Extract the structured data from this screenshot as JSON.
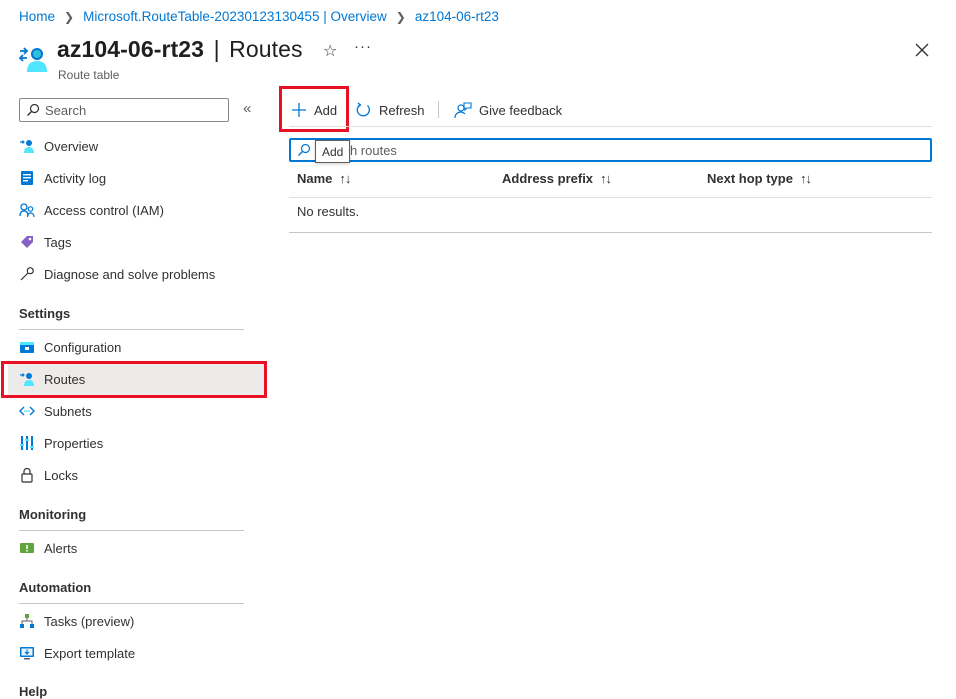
{
  "breadcrumb": {
    "items": [
      "Home",
      "Microsoft.RouteTable-20230123130455 | Overview",
      "az104-06-rt23"
    ]
  },
  "header": {
    "resource_name": "az104-06-rt23",
    "separator": "|",
    "page": "Routes",
    "subtitle": "Route table",
    "more_glyph": "···"
  },
  "sidebar": {
    "search_placeholder": "Search",
    "collapse_glyph": "«",
    "items": [
      {
        "label": "Overview",
        "icon": "route-table-icon"
      },
      {
        "label": "Activity log",
        "icon": "activity-log-icon"
      },
      {
        "label": "Access control (IAM)",
        "icon": "iam-icon"
      },
      {
        "label": "Tags",
        "icon": "tag-icon"
      },
      {
        "label": "Diagnose and solve problems",
        "icon": "wrench-icon"
      }
    ],
    "sections": [
      {
        "title": "Settings",
        "items": [
          {
            "label": "Configuration",
            "icon": "configuration-icon"
          },
          {
            "label": "Routes",
            "icon": "routes-icon",
            "selected": true
          },
          {
            "label": "Subnets",
            "icon": "subnets-icon"
          },
          {
            "label": "Properties",
            "icon": "properties-icon"
          },
          {
            "label": "Locks",
            "icon": "lock-icon"
          }
        ]
      },
      {
        "title": "Monitoring",
        "items": [
          {
            "label": "Alerts",
            "icon": "alerts-icon"
          }
        ]
      },
      {
        "title": "Automation",
        "items": [
          {
            "label": "Tasks (preview)",
            "icon": "tasks-icon"
          },
          {
            "label": "Export template",
            "icon": "export-template-icon"
          }
        ]
      },
      {
        "title": "Help",
        "items": []
      }
    ]
  },
  "toolbar": {
    "add_label": "Add",
    "refresh_label": "Refresh",
    "feedback_label": "Give feedback"
  },
  "filter": {
    "placeholder": "Search routes",
    "tooltip": "Add"
  },
  "table": {
    "columns": [
      "Name",
      "Address prefix",
      "Next hop type"
    ],
    "sort_glyph": "↑↓",
    "empty_text": "No results."
  },
  "colors": {
    "accent": "#0078d4",
    "highlight_box": "#e81123",
    "selected_bg": "#edebe9"
  }
}
